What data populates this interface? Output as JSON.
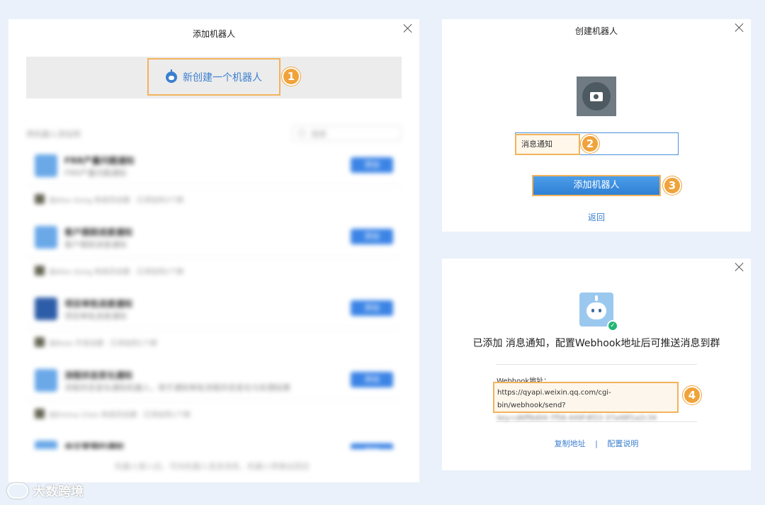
{
  "left_dialog": {
    "title": "添加机器人",
    "new_button_label": "新创建一个机器人",
    "step": "1",
    "list_header": "将机器人添加到",
    "search_placeholder": "搜索",
    "items": [
      {
        "name": "FRR产量问题通知",
        "desc": "FRR产量问题通知",
        "action": "添加",
        "by": "由Alex Gong 和成员创建 · 已添加到3个群"
      },
      {
        "name": "客户跟踪进度通知",
        "desc": "客户跟踪进度通知",
        "action": "添加",
        "by": "由Alex Gong 和成员创建 · 已添加到2个群"
      },
      {
        "name": "项目审批进度通知",
        "desc": "项目审批进度通知",
        "action": "添加",
        "by": "由Rose 开发创建 · 已添加到1个群"
      },
      {
        "name": "流程状态变化通知",
        "desc": "流程状态变化通知机器人，用于通知审批流程状态变化与处理结果",
        "action": "添加",
        "by": "由Emma Chen 和成员创建 · 已添加到1个群"
      },
      {
        "name": "会议室预约通知",
        "desc": "",
        "action": "添加",
        "by": ""
      }
    ],
    "footer_note": "机器人接入后，可向机器人发送消息，机器人将做出回应"
  },
  "create_dialog": {
    "title": "创建机器人",
    "name_value": "消息通知",
    "step_name": "2",
    "add_button_label": "添加机器人",
    "step_add": "3",
    "back_label": "返回"
  },
  "result_dialog": {
    "message": "已添加 消息通知，配置Webhook地址后可推送消息到群",
    "webhook_label": "Webhook地址：",
    "webhook_url": "https://qyapi.weixin.qq.com/cgi-bin/webhook/send?",
    "webhook_key": "key=d6ff6d04-7f56-449f-8f22-37a48f1a2c34",
    "step": "4",
    "copy_label": "复制地址",
    "separator": "|",
    "config_label": "配置说明"
  },
  "watermark": {
    "text": "大数跨境"
  },
  "colors": {
    "accent": "#3b7fcf",
    "highlight": "#f2b35b",
    "badge": "#f0a33b",
    "success": "#22b573"
  }
}
